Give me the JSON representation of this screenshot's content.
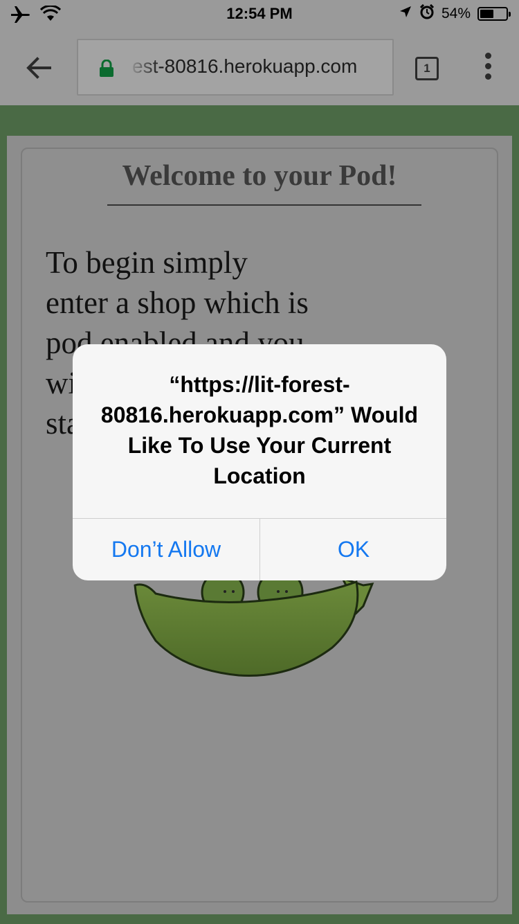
{
  "status_bar": {
    "time": "12:54 PM",
    "battery_percent": "54%",
    "battery_level": 0.54,
    "icons": [
      "airplane-icon",
      "wifi-icon",
      "location-arrow-icon",
      "alarm-icon",
      "battery-icon"
    ]
  },
  "browser": {
    "url_display": "est-80816.herokuapp.com",
    "tab_count": "1",
    "icons": [
      "back-arrow-icon",
      "lock-icon",
      "tabs-icon",
      "more-menu-icon"
    ],
    "lock_color": "#0b6b2f"
  },
  "page": {
    "title": "Welcome to your Pod!",
    "intro_lines": [
      "To begin simply",
      "enter a shop which is",
      "pod enabled and you",
      "wi",
      "sta"
    ]
  },
  "alert": {
    "message": "“https://lit-forest-80816.herokuapp.com” Would Like To Use Your Current Location",
    "deny_label": "Don’t Allow",
    "ok_label": "OK",
    "button_color": "#1478f0"
  }
}
